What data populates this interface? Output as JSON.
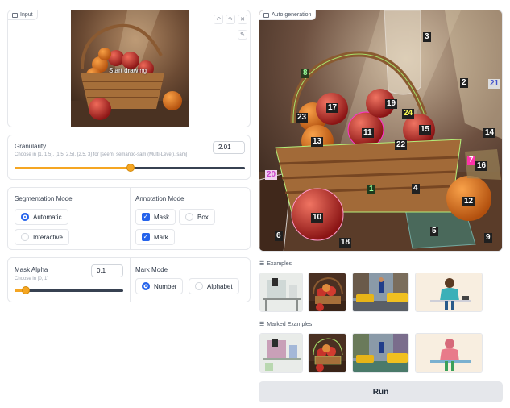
{
  "input_panel": {
    "label": "Input",
    "overlay_text": "Start drawing",
    "tool_icons": [
      "undo-icon",
      "redo-icon",
      "close-icon",
      "brush-icon"
    ]
  },
  "granularity": {
    "label": "Granularity",
    "hint": "Choose in [1, 1.5), [1.5, 2.5), [2.5, 3] for [seem, semantic-sam (Multi-Level), sam]",
    "value": "2.01",
    "fraction": 0.505
  },
  "segmentation_mode": {
    "label": "Segmentation Mode",
    "options": [
      "Automatic",
      "Interactive"
    ],
    "selected": "Automatic"
  },
  "annotation_mode": {
    "label": "Annotation Mode",
    "options": [
      "Mask",
      "Box",
      "Mark"
    ],
    "checked": [
      "Mask",
      "Mark"
    ]
  },
  "mask_alpha": {
    "label": "Mask Alpha",
    "hint": "Choose in [0, 1]",
    "value": "0.1",
    "fraction": 0.1
  },
  "mark_mode": {
    "label": "Mark Mode",
    "options": [
      "Number",
      "Alphabet"
    ],
    "selected": "Number"
  },
  "output_panel": {
    "label": "Auto generation",
    "marks": [
      "1",
      "2",
      "3",
      "4",
      "5",
      "6",
      "7",
      "8",
      "9",
      "10",
      "11",
      "12",
      "13",
      "14",
      "15",
      "16",
      "17",
      "18",
      "19",
      "20",
      "21",
      "22",
      "23",
      "24"
    ]
  },
  "examples": {
    "label": "Examples"
  },
  "marked_examples": {
    "label": "Marked Examples"
  },
  "run_button": {
    "label": "Run"
  },
  "colors": {
    "accent": "#f5a623",
    "primary": "#2563eb",
    "run_bg": "#e5e7eb"
  }
}
